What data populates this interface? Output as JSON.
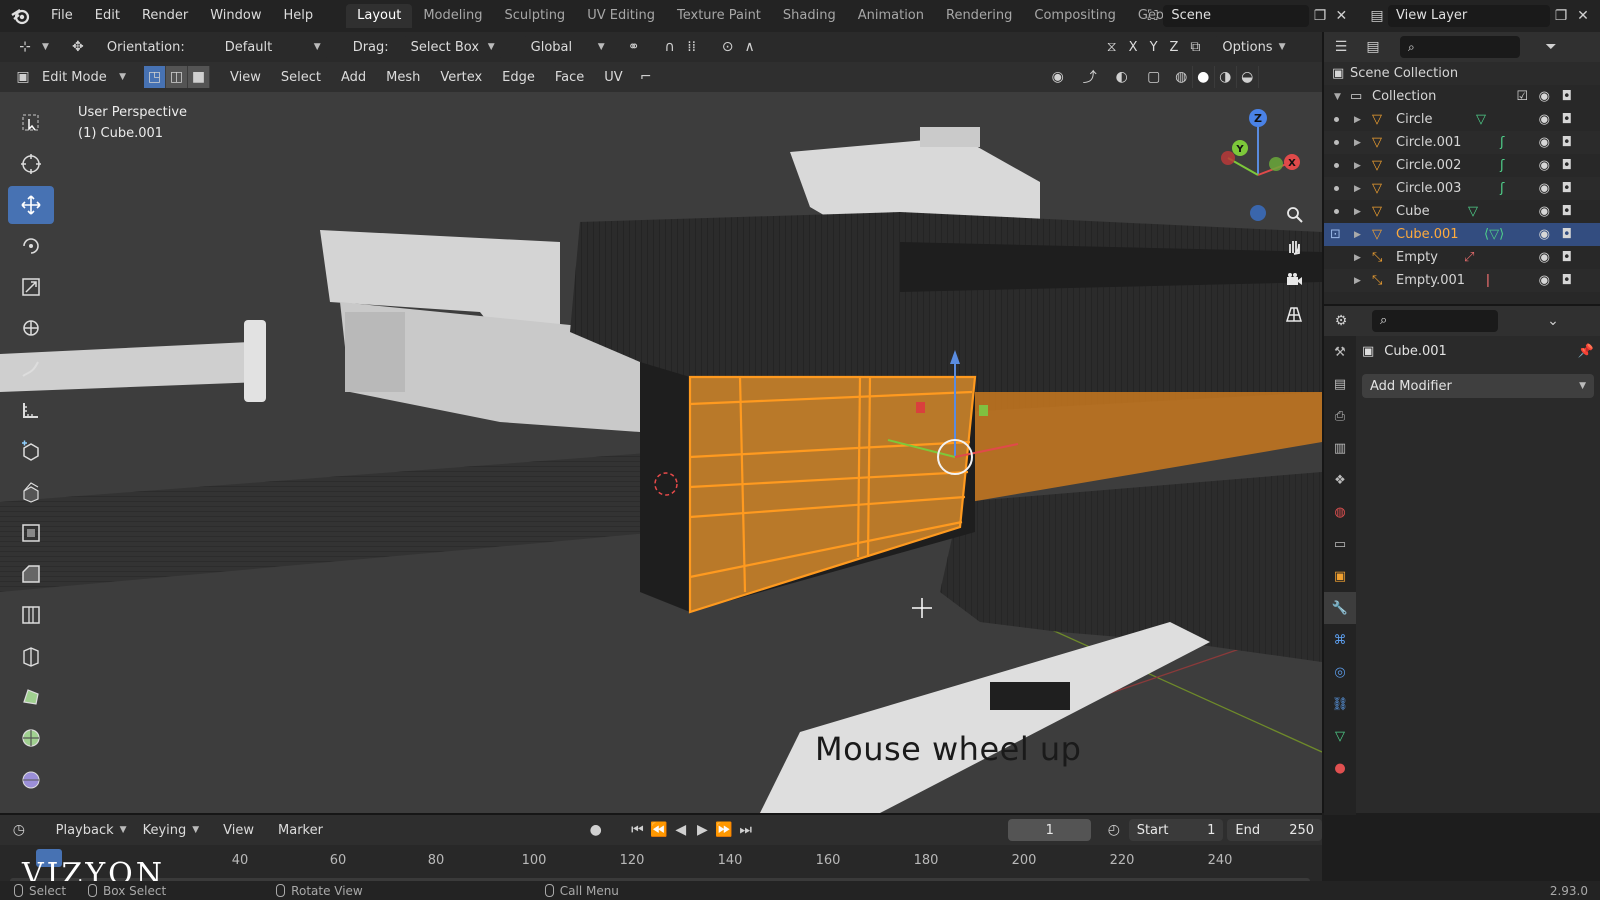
{
  "menu": {
    "items": [
      "File",
      "Edit",
      "Render",
      "Window",
      "Help"
    ]
  },
  "workspaces": {
    "tabs": [
      "Layout",
      "Modeling",
      "Sculpting",
      "UV Editing",
      "Texture Paint",
      "Shading",
      "Animation",
      "Rendering",
      "Compositing",
      "Geometry Nod"
    ],
    "active": "Layout"
  },
  "scene": {
    "name": "Scene"
  },
  "view_layer": {
    "name": "View Layer"
  },
  "tool_header": {
    "orientation_label": "Orientation:",
    "orientation_value": "Default",
    "drag_label": "Drag:",
    "drag_value": "Select Box",
    "transform_orientation": "Global",
    "axes": [
      "X",
      "Y",
      "Z"
    ],
    "options": "Options"
  },
  "viewport_header": {
    "mode": "Edit Mode",
    "menus": [
      "View",
      "Select",
      "Add",
      "Mesh",
      "Vertex",
      "Edge",
      "Face",
      "UV"
    ]
  },
  "viewport": {
    "perspective": "User Perspective",
    "object_info": "(1) Cube.001",
    "overlay_text": "Mouse wheel up",
    "gizmo_axes": [
      "Z",
      "Y",
      "X"
    ]
  },
  "outliner": {
    "root": "Scene Collection",
    "collection": "Collection",
    "items": [
      {
        "name": "Circle",
        "selected": false
      },
      {
        "name": "Circle.001",
        "selected": false
      },
      {
        "name": "Circle.002",
        "selected": false
      },
      {
        "name": "Circle.003",
        "selected": false
      },
      {
        "name": "Cube",
        "selected": false
      },
      {
        "name": "Cube.001",
        "selected": true
      },
      {
        "name": "Empty",
        "selected": false
      },
      {
        "name": "Empty.001",
        "selected": false
      }
    ]
  },
  "properties": {
    "object_name": "Cube.001",
    "add_modifier": "Add Modifier"
  },
  "timeline": {
    "menus": [
      "Playback",
      "Keying",
      "View",
      "Marker"
    ],
    "current_frame": "1",
    "start_label": "Start",
    "start_value": "1",
    "end_label": "End",
    "end_value": "250",
    "ticks": [
      "40",
      "60",
      "80",
      "100",
      "120",
      "140",
      "160",
      "180",
      "200",
      "220",
      "240"
    ],
    "watermark": "VIZYON"
  },
  "status": {
    "select": "Select",
    "box_select": "Box Select",
    "rotate_view": "Rotate View",
    "call_menu": "Call Menu",
    "version": "2.93.0"
  },
  "colors": {
    "accent": "#4772b3",
    "selection": "#ffab3c",
    "viewport_bg": "#3d3d3d",
    "outliner_selected": "#334d80"
  }
}
